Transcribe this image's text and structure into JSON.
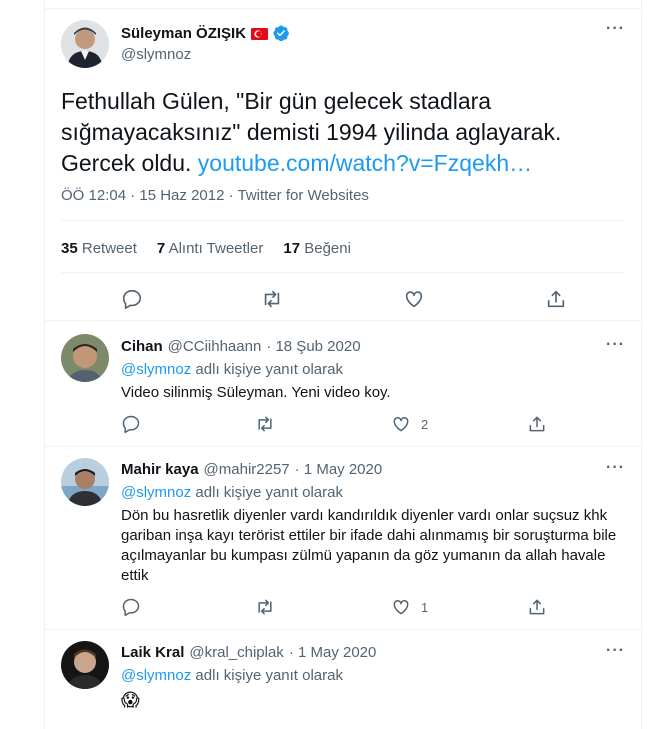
{
  "main_tweet": {
    "author_name": "Süleyman ÖZIŞIK",
    "author_handle": "@slymnoz",
    "text_plain": "Fethullah Gülen, \"Bir gün gelecek stadlara sığmayacaksınız\" demisti 1994 yilinda aglayarak. Gercek oldu.",
    "text_link": "youtube.com/watch?v=Fzqekh…",
    "meta": "ÖÖ 12:04 · 15 Haz 2012 · Twitter for Websites",
    "stats": {
      "retweets_count": "35",
      "retweets_label": "Retweet",
      "quotes_count": "7",
      "quotes_label": "Alıntı Tweetler",
      "likes_count": "17",
      "likes_label": "Beğeni"
    }
  },
  "replies": [
    {
      "name": "Cihan",
      "handle": "@CCiihhaann",
      "date": "· 18 Şub 2020",
      "reply_to_handle": "@slymnoz",
      "reply_to_suffix": "adlı kişiye yanıt olarak",
      "text": "Video silinmiş Süleyman. Yeni video koy.",
      "likes": "2"
    },
    {
      "name": "Mahir kaya",
      "handle": "@mahir2257",
      "date": "· 1 May 2020",
      "reply_to_handle": "@slymnoz",
      "reply_to_suffix": "adlı kişiye yanıt olarak",
      "text": "Dön bu hasretlik diyenler vardı kandırıldık diyenler vardı onlar suçsuz khk gariban inşa kayı terörist ettiler  bir ifade dahi alınmamış bir soruşturma bile açılmayanlar bu kumpası zülmü yapanın da göz yumanın da allah havale ettik",
      "likes": "1"
    },
    {
      "name": "Laik Kral",
      "handle": "@kral_chiplak",
      "date": "· 1 May 2020",
      "reply_to_handle": "@slymnoz",
      "reply_to_suffix": "adlı kişiye yanıt olarak",
      "text": "😱",
      "likes": ""
    }
  ],
  "icons": {
    "more": "more-icon",
    "verified": "verified-badge-icon",
    "flag": "turkey-flag-icon",
    "reply": "reply-icon",
    "retweet": "retweet-icon",
    "like": "like-icon",
    "share": "share-icon"
  },
  "colors": {
    "accent": "#1d9bf0",
    "secondary_text": "#536471",
    "divider": "#eff3f4",
    "flag_red": "#e30a17"
  }
}
